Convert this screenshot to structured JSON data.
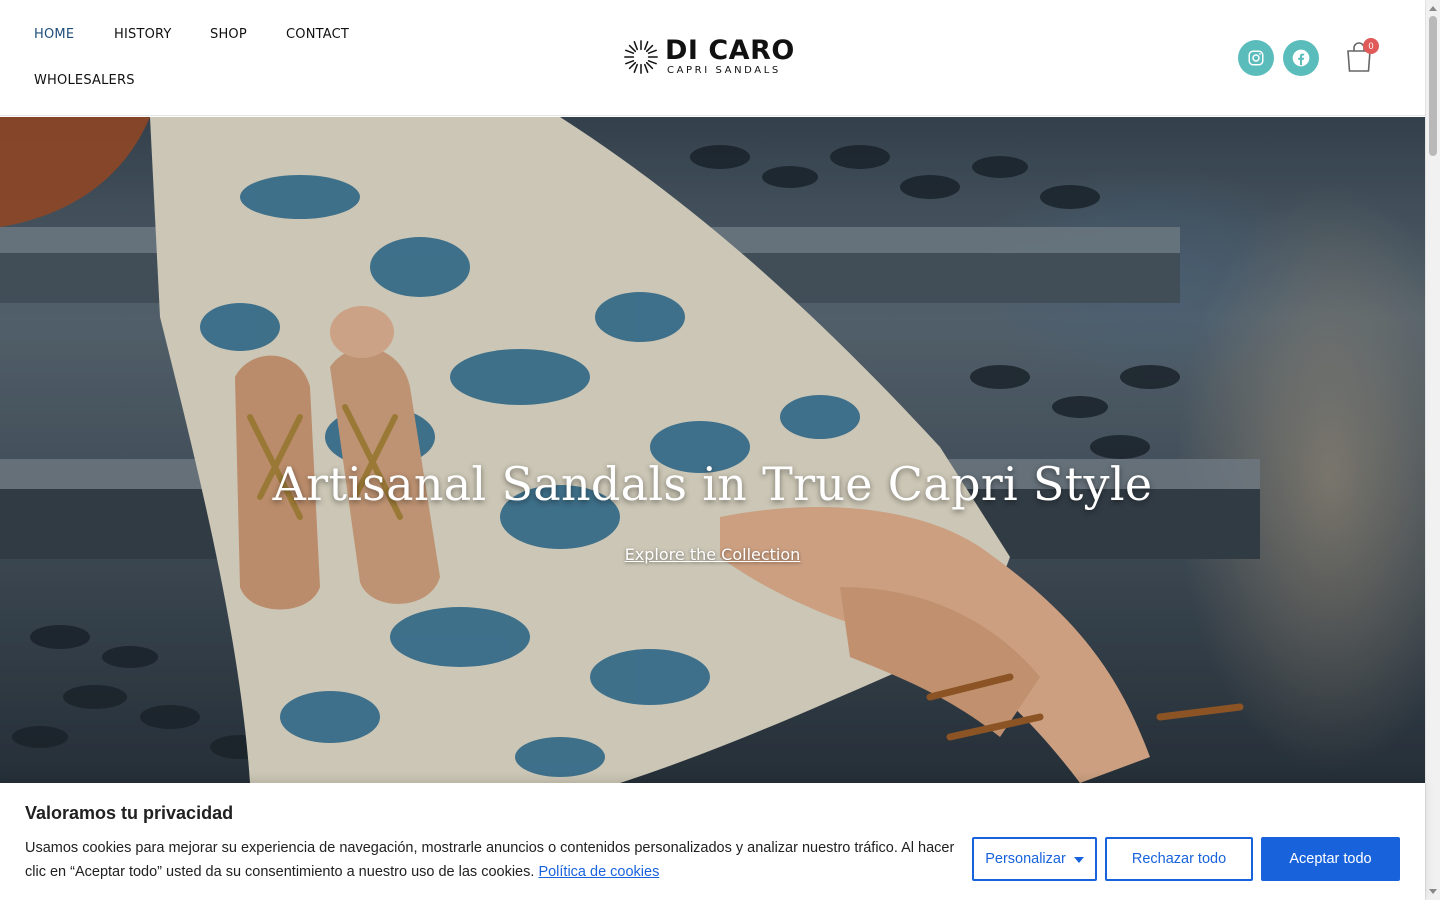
{
  "nav": {
    "items": [
      {
        "label": "HOME",
        "active": true
      },
      {
        "label": "HISTORY",
        "active": false
      },
      {
        "label": "SHOP",
        "active": false
      },
      {
        "label": "CONTACT",
        "active": false
      },
      {
        "label": "WHOLESALERS",
        "active": false
      }
    ]
  },
  "logo": {
    "title": "DI CARO",
    "subtitle": "CAPRI SANDALS"
  },
  "social": [
    {
      "icon": "instagram-icon"
    },
    {
      "icon": "facebook-icon"
    }
  ],
  "cart": {
    "icon": "shopping-bag-icon",
    "count": "0"
  },
  "hero": {
    "title": "Artisanal Sandals in True Capri Style",
    "link": "Explore the Collection"
  },
  "cookie": {
    "title": "Valoramos tu privacidad",
    "text": "Usamos cookies para mejorar su experiencia de navegación, mostrarle anuncios o contenidos personalizados y analizar nuestro tráfico. Al hacer clic en “Aceptar todo” usted da su consentimiento a nuestro uso de las cookies.",
    "policy_link": "Política de cookies",
    "customize": "Personalizar",
    "reject": "Rechazar todo",
    "accept": "Aceptar todo"
  },
  "colors": {
    "accent": "#1863dc",
    "social": "#5bbcbc",
    "badge": "#e05a5a",
    "nav_active": "#1e4d7a"
  }
}
